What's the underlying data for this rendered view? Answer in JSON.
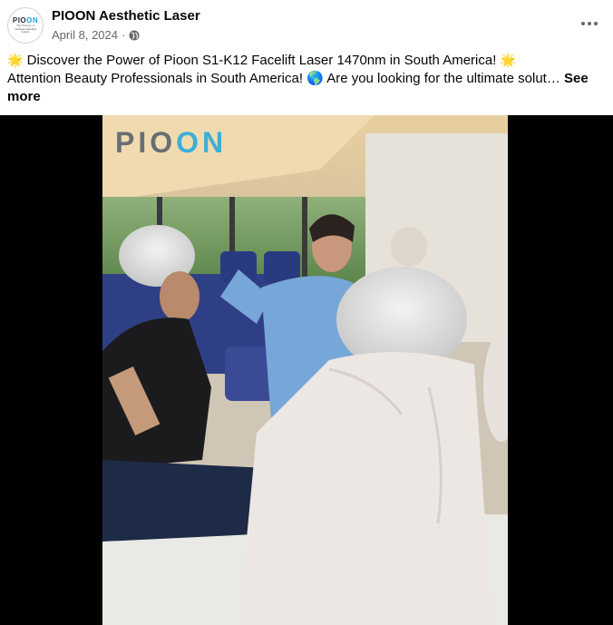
{
  "post": {
    "author": "PIOON Aesthetic Laser",
    "date": "April 8, 2024",
    "separator": "·",
    "avatar": {
      "logo_prefix": "PIO",
      "logo_accent": "ON",
      "tagline": "The Pioneer of Intelligent Medical Lasers"
    },
    "caption_line1": "Discover the Power of Pioon S1-K12 Facelift Laser 1470nm in South America!",
    "caption_line2": "Attention Beauty Professionals in South America! 🌎 Are you looking for the ultimate solut…",
    "see_more_1": "See",
    "see_more_2": "more",
    "sparkle_emoji": "🌟",
    "video": {
      "watermark_prefix": "PIO",
      "watermark_accent": "ON"
    }
  },
  "icons": {
    "globe": "globe-icon",
    "more": "more-options-icon"
  },
  "colors": {
    "brand_cyan": "#1da6d8",
    "meta_gray": "#65676b"
  }
}
